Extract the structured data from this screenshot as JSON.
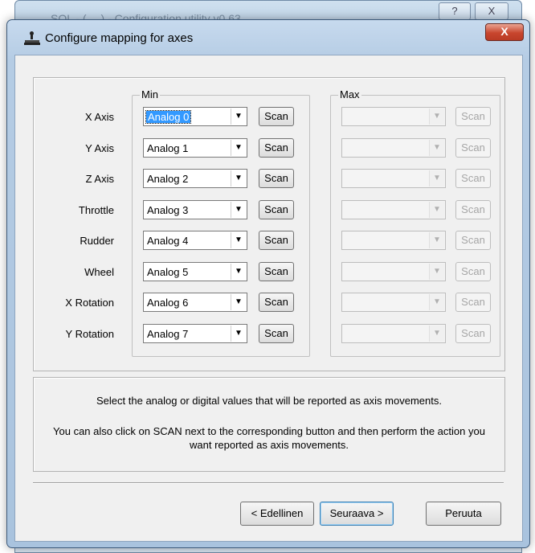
{
  "background_window": {
    "title": "SOL - (… ) - Configuration utility v0.63",
    "help_glyph": "?",
    "close_glyph": "X"
  },
  "dialog": {
    "title": "Configure mapping for axes",
    "title_icon": "joystick-icon",
    "close_glyph": "X"
  },
  "axes": {
    "min_label": "Min",
    "max_label": "Max",
    "scan_label": "Scan",
    "rows": [
      {
        "label": "X Axis",
        "min_value": "Analog 0",
        "max_value": ""
      },
      {
        "label": "Y Axis",
        "min_value": "Analog 1",
        "max_value": ""
      },
      {
        "label": "Z Axis",
        "min_value": "Analog 2",
        "max_value": ""
      },
      {
        "label": "Throttle",
        "min_value": "Analog 3",
        "max_value": ""
      },
      {
        "label": "Rudder",
        "min_value": "Analog 4",
        "max_value": ""
      },
      {
        "label": "Wheel",
        "min_value": "Analog 5",
        "max_value": ""
      },
      {
        "label": "X Rotation",
        "min_value": "Analog 6",
        "max_value": ""
      },
      {
        "label": "Y Rotation",
        "min_value": "Analog 7",
        "max_value": ""
      }
    ]
  },
  "description": {
    "line1": "Select the analog or digital values that will be reported as axis movements.",
    "line2": "You can also click on SCAN next to the corresponding button and then perform the action you want reported as axis movements."
  },
  "footer": {
    "back_label": "< Edellinen",
    "next_label": "Seuraava >",
    "cancel_label": "Peruuta"
  },
  "colors": {
    "selection": "#3399ff",
    "close_button": "#c8462e",
    "frame": "#b5cce4"
  }
}
